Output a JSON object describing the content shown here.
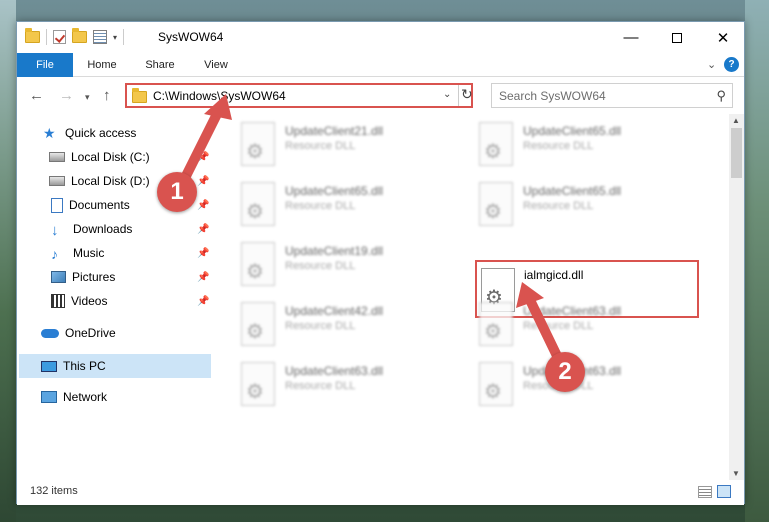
{
  "window": {
    "title": "SysWOW64",
    "controls": {
      "minimize": "—",
      "maximize": "",
      "close": "✕"
    }
  },
  "ribbon": {
    "tabs": [
      "File",
      "Home",
      "Share",
      "View"
    ],
    "help": "?"
  },
  "navigation": {
    "address_path": "C:\\Windows\\SysWOW64",
    "search_placeholder": "Search SysWOW64"
  },
  "sidebar": {
    "items": [
      {
        "label": "Quick access",
        "icon": "star-icon",
        "pinned": false
      },
      {
        "label": "Local Disk (C:)",
        "icon": "disk-icon",
        "pinned": true
      },
      {
        "label": "Local Disk (D:)",
        "icon": "disk-icon",
        "pinned": true
      },
      {
        "label": "Documents",
        "icon": "documents-icon",
        "pinned": true
      },
      {
        "label": "Downloads",
        "icon": "downloads-icon",
        "pinned": true
      },
      {
        "label": "Music",
        "icon": "music-icon",
        "pinned": true
      },
      {
        "label": "Pictures",
        "icon": "pictures-icon",
        "pinned": true
      },
      {
        "label": "Videos",
        "icon": "videos-icon",
        "pinned": true
      },
      {
        "label": "OneDrive",
        "icon": "onedrive-icon",
        "pinned": false
      },
      {
        "label": "This PC",
        "icon": "pc-icon",
        "pinned": false,
        "selected": true
      },
      {
        "label": "Network",
        "icon": "network-icon",
        "pinned": false
      }
    ]
  },
  "files": [
    {
      "name": "UpdateClient21.dll",
      "type": "Resource DLL"
    },
    {
      "name": "UpdateClient65.dll",
      "type": "Resource DLL"
    },
    {
      "name": "UpdateClient65.dll",
      "type": "Resource DLL"
    },
    {
      "name": "UpdateClient65.dll",
      "type": "Resource DLL"
    },
    {
      "name": "UpdateClient19.dll",
      "type": "Resource DLL"
    },
    {
      "name": "ialmgicd.dll",
      "type": "",
      "highlighted": true
    },
    {
      "name": "UpdateClient42.dll",
      "type": "Resource DLL"
    },
    {
      "name": "UpdateClient63.dll",
      "type": "Resource DLL"
    },
    {
      "name": "UpdateClient63.dll",
      "type": "Resource DLL"
    },
    {
      "name": "UpdateClient63.dll",
      "type": "Resource DLL"
    }
  ],
  "status": {
    "item_count": "132 items"
  },
  "annotations": {
    "marker_1": "1",
    "marker_2": "2",
    "highlight_color": "#d9534f"
  },
  "colors": {
    "accent": "#1979ca",
    "selection": "#cce4f7"
  }
}
